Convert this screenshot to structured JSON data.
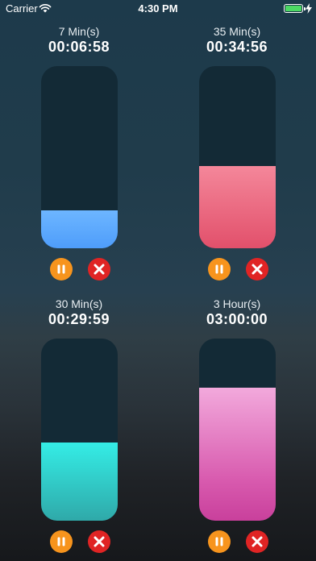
{
  "status_bar": {
    "carrier": "Carrier",
    "time": "4:30 PM",
    "battery_level": 1.0,
    "battery_color": "#4cd964"
  },
  "timers": [
    {
      "duration": "7 Min(s)",
      "remaining": "00:06:58",
      "fill_fraction": 0.21,
      "fill_color": "#5aa8fd"
    },
    {
      "duration": "35 Min(s)",
      "remaining": "00:34:56",
      "fill_fraction": 0.45,
      "fill_color": "#ea6780"
    },
    {
      "duration": "30 Min(s)",
      "remaining": "00:29:59",
      "fill_fraction": 0.43,
      "fill_color": "#31d5d0"
    },
    {
      "duration": "3 Hour(s)",
      "remaining": "03:00:00",
      "fill_fraction": 0.73,
      "fill_color": "#de6ab6"
    }
  ],
  "icons": {
    "pause": "pause-icon",
    "cancel": "close-icon",
    "pause_color": "#f7941d",
    "cancel_color": "#e02424"
  }
}
